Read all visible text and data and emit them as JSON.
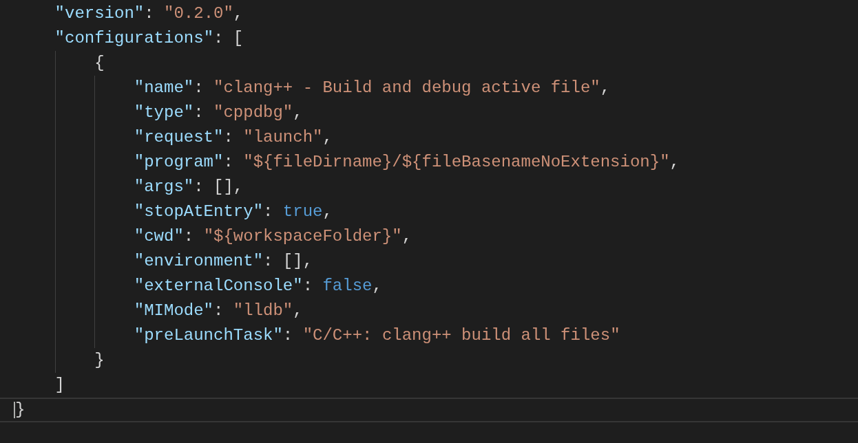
{
  "editor": {
    "lines": [
      {
        "children": [
          {
            "tokens": [
              {
                "kind": "key",
                "text": "\"version\""
              },
              {
                "kind": "punct",
                "text": ": "
              },
              {
                "kind": "string",
                "text": "\"0.2.0\""
              },
              {
                "kind": "punct",
                "text": ","
              }
            ]
          },
          {
            "tokens": [
              {
                "kind": "key",
                "text": "\"configurations\""
              },
              {
                "kind": "punct",
                "text": ": ["
              }
            ],
            "children": [
              {
                "tokens": [
                  {
                    "kind": "punct",
                    "text": "{"
                  }
                ],
                "children": [
                  {
                    "current": false,
                    "tokens": [
                      {
                        "kind": "key",
                        "text": "\"name\""
                      },
                      {
                        "kind": "punct",
                        "text": ": "
                      },
                      {
                        "kind": "string",
                        "text": "\"clang++ - Build and debug active file\""
                      },
                      {
                        "kind": "punct",
                        "text": ","
                      }
                    ]
                  },
                  {
                    "current": false,
                    "tokens": [
                      {
                        "kind": "key",
                        "text": "\"type\""
                      },
                      {
                        "kind": "punct",
                        "text": ": "
                      },
                      {
                        "kind": "string",
                        "text": "\"cppdbg\""
                      },
                      {
                        "kind": "punct",
                        "text": ","
                      }
                    ]
                  },
                  {
                    "current": false,
                    "tokens": [
                      {
                        "kind": "key",
                        "text": "\"request\""
                      },
                      {
                        "kind": "punct",
                        "text": ": "
                      },
                      {
                        "kind": "string",
                        "text": "\"launch\""
                      },
                      {
                        "kind": "punct",
                        "text": ","
                      }
                    ]
                  },
                  {
                    "current": false,
                    "tokens": [
                      {
                        "kind": "key",
                        "text": "\"program\""
                      },
                      {
                        "kind": "punct",
                        "text": ": "
                      },
                      {
                        "kind": "string",
                        "text": "\"${fileDirname}/${fileBasenameNoExtension}\""
                      },
                      {
                        "kind": "punct",
                        "text": ","
                      }
                    ]
                  },
                  {
                    "current": false,
                    "tokens": [
                      {
                        "kind": "key",
                        "text": "\"args\""
                      },
                      {
                        "kind": "punct",
                        "text": ": [],"
                      }
                    ]
                  },
                  {
                    "current": false,
                    "tokens": [
                      {
                        "kind": "key",
                        "text": "\"stopAtEntry\""
                      },
                      {
                        "kind": "punct",
                        "text": ": "
                      },
                      {
                        "kind": "keyword",
                        "text": "true"
                      },
                      {
                        "kind": "punct",
                        "text": ","
                      }
                    ]
                  },
                  {
                    "current": false,
                    "tokens": [
                      {
                        "kind": "key",
                        "text": "\"cwd\""
                      },
                      {
                        "kind": "punct",
                        "text": ": "
                      },
                      {
                        "kind": "string",
                        "text": "\"${workspaceFolder}\""
                      },
                      {
                        "kind": "punct",
                        "text": ","
                      }
                    ]
                  },
                  {
                    "current": false,
                    "tokens": [
                      {
                        "kind": "key",
                        "text": "\"environment\""
                      },
                      {
                        "kind": "punct",
                        "text": ": [],"
                      }
                    ]
                  },
                  {
                    "current": false,
                    "tokens": [
                      {
                        "kind": "key",
                        "text": "\"externalConsole\""
                      },
                      {
                        "kind": "punct",
                        "text": ": "
                      },
                      {
                        "kind": "keyword",
                        "text": "false"
                      },
                      {
                        "kind": "punct",
                        "text": ","
                      }
                    ]
                  },
                  {
                    "current": false,
                    "tokens": [
                      {
                        "kind": "key",
                        "text": "\"MIMode\""
                      },
                      {
                        "kind": "punct",
                        "text": ": "
                      },
                      {
                        "kind": "string",
                        "text": "\"lldb\""
                      },
                      {
                        "kind": "punct",
                        "text": ","
                      }
                    ]
                  },
                  {
                    "current": false,
                    "tokens": [
                      {
                        "kind": "key",
                        "text": "\"preLaunchTask\""
                      },
                      {
                        "kind": "punct",
                        "text": ": "
                      },
                      {
                        "kind": "string",
                        "text": "\"C/C++: clang++ build all files\""
                      }
                    ]
                  }
                ]
              },
              {
                "current": false,
                "tokens": [
                  {
                    "kind": "punct",
                    "text": "}"
                  }
                ]
              }
            ]
          },
          {
            "current": false,
            "tokens": [
              {
                "kind": "punct",
                "text": "]"
              }
            ]
          }
        ]
      },
      {
        "current": true,
        "tokens": [
          {
            "kind": "punct",
            "text": "}"
          }
        ]
      }
    ]
  }
}
